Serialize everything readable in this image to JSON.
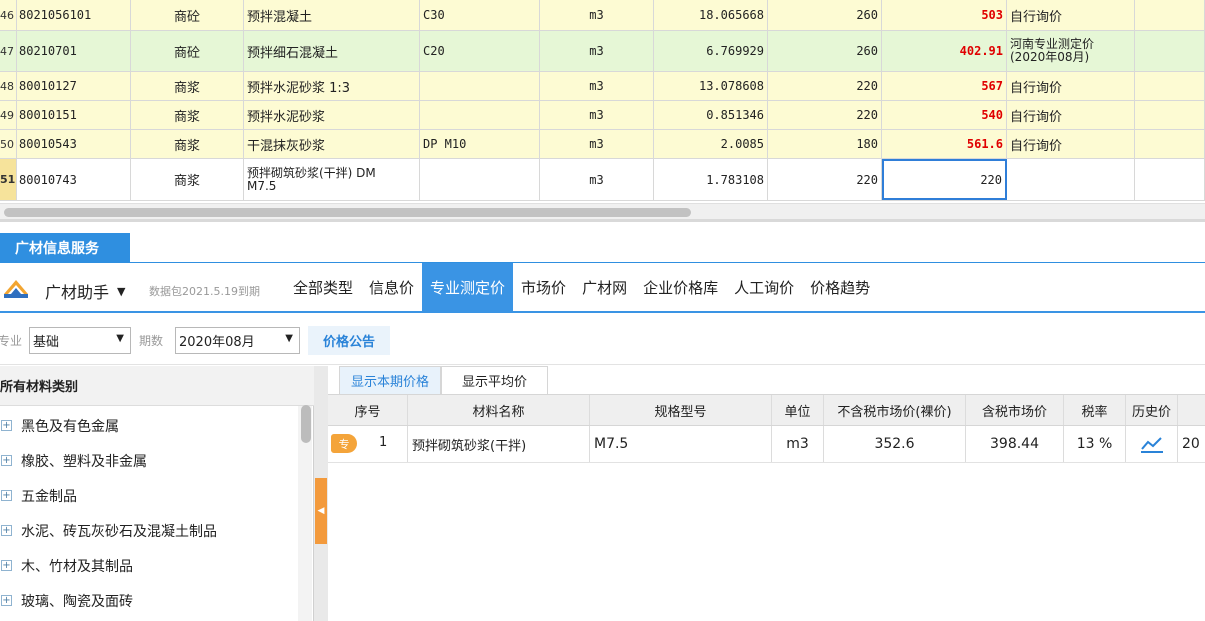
{
  "top_grid": {
    "rows": [
      {
        "idx": "46",
        "code": "8021056101",
        "type": "商砼",
        "name": "预拌混凝土",
        "spec": "C30",
        "unit": "m3",
        "qty": "18.065668",
        "price": "260",
        "market_price": "503",
        "source": "自行询价",
        "style": "yellow"
      },
      {
        "idx": "47",
        "code": "80210701",
        "type": "商砼",
        "name": "预拌细石混凝土",
        "spec": "C20",
        "unit": "m3",
        "qty": "6.769929",
        "price": "260",
        "market_price": "402.91",
        "source": "河南专业测定价\n(2020年08月)",
        "style": "green"
      },
      {
        "idx": "48",
        "code": "80010127",
        "type": "商浆",
        "name": "预拌水泥砂浆 1:3",
        "spec": "",
        "unit": "m3",
        "qty": "13.078608",
        "price": "220",
        "market_price": "567",
        "source": "自行询价",
        "style": "yellow"
      },
      {
        "idx": "49",
        "code": "80010151",
        "type": "商浆",
        "name": "预拌水泥砂浆",
        "spec": "",
        "unit": "m3",
        "qty": "0.851346",
        "price": "220",
        "market_price": "540",
        "source": "自行询价",
        "style": "yellow"
      },
      {
        "idx": "50",
        "code": "80010543",
        "type": "商浆",
        "name": "干混抹灰砂浆",
        "spec": "DP M10",
        "unit": "m3",
        "qty": "2.0085",
        "price": "180",
        "market_price": "561.6",
        "source": "自行询价",
        "style": "yellow"
      },
      {
        "idx": "51",
        "code": "80010743",
        "type": "商浆",
        "name": "预拌砌筑砂浆(干拌) DM\nM7.5",
        "spec": "",
        "unit": "m3",
        "qty": "1.783108",
        "price": "220",
        "market_price": "220",
        "source": "",
        "style": "white"
      }
    ]
  },
  "panel": {
    "tab_label": "广材信息服务",
    "brand": "广材助手",
    "brand_caret": "▼",
    "package_info": "数据包2021.5.19到期",
    "tabs": [
      "全部类型",
      "信息价",
      "专业测定价",
      "市场价",
      "广材网",
      "企业价格库",
      "人工询价",
      "价格趋势"
    ],
    "active_tab": "专业测定价"
  },
  "filter": {
    "specialty_label": "专业",
    "specialty_value": "基础",
    "period_label": "期数",
    "period_value": "2020年08月",
    "notice_button": "价格公告",
    "dropdown_arrow": "▼"
  },
  "tree": {
    "header": "所有材料类别",
    "items": [
      "黑色及有色金属",
      "橡胶、塑料及非金属",
      "五金制品",
      "水泥、砖瓦灰砂石及混凝土制品",
      "木、竹材及其制品",
      "玻璃、陶瓷及面砖"
    ]
  },
  "results": {
    "subtabs": [
      "显示本期价格",
      "显示平均价"
    ],
    "headers": {
      "no": "序号",
      "name": "材料名称",
      "spec": "规格型号",
      "unit": "单位",
      "ex_tax": "不含税市场价(裸价)",
      "in_tax": "含税市场价",
      "rate": "税率",
      "history": "历史价"
    },
    "rows": [
      {
        "tag": "专",
        "no": "1",
        "name": "预拌砌筑砂浆(干拌)",
        "spec": "M7.5",
        "unit": "m3",
        "ex_tax": "352.6",
        "in_tax": "398.44",
        "rate": "13 %",
        "more": "20"
      }
    ]
  },
  "colors": {
    "accent": "#3a94e4",
    "price_red": "#e00000",
    "yellow_row": "#fdfbd3",
    "green_row": "#e6f7d6",
    "orange": "#f39a3c"
  }
}
